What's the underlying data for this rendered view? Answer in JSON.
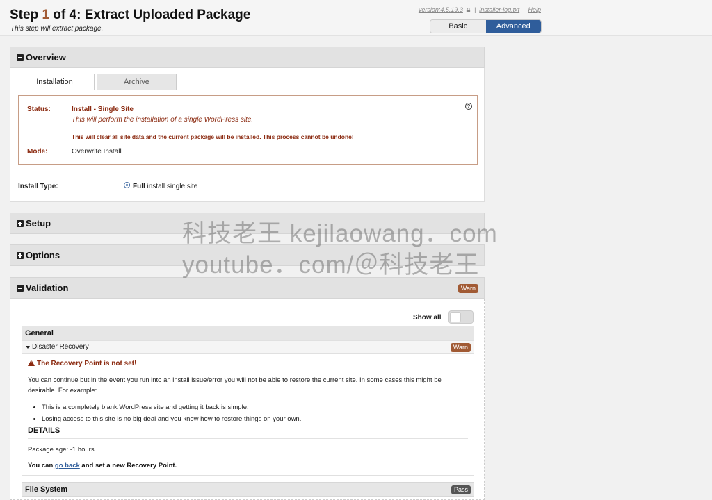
{
  "header": {
    "title_prefix": "Step ",
    "step_number": "1",
    "title_suffix": " of 4: Extract Uploaded Package",
    "subtitle": "This step will extract package.",
    "links": {
      "version": "version:4.5.19.3",
      "log": "installer-log.txt",
      "help": "Help",
      "sep1": "|",
      "sep2": "|"
    },
    "view_toggle": {
      "basic": "Basic",
      "advanced": "Advanced"
    }
  },
  "overview": {
    "title": "Overview",
    "tabs": [
      {
        "label": "Installation"
      },
      {
        "label": "Archive"
      }
    ],
    "status_label": "Status:",
    "status_value": "Install - Single Site",
    "status_desc": "This will perform the installation of a single WordPress site.",
    "warning": "This will clear all site data and the current package will be installed. This process cannot be undone!",
    "mode_label": "Mode:",
    "mode_value": "Overwrite Install",
    "help_glyph": "?",
    "install_type_label": "Install Type:",
    "install_type_bold": "Full",
    "install_type_rest": " install single site"
  },
  "setup": {
    "title": "Setup"
  },
  "options": {
    "title": "Options"
  },
  "validation": {
    "title": "Validation",
    "badge": "Warn",
    "show_all": "Show all",
    "general": {
      "title": "General",
      "disaster": {
        "title": "Disaster Recovery",
        "badge": "Warn",
        "alert": "The Recovery Point is not set!",
        "paragraph": "You can continue but in the event you run into an install issue/error you will not be able to restore the current site. In some cases this might be desirable. For example:",
        "bullets": [
          "This is a completely blank WordPress site and getting it back is simple.",
          "Losing access to this site is no big deal and you know how to restore things on your own."
        ],
        "details_heading": "DETAILS",
        "package_age": "Package age: -1 hours",
        "go_back_prefix": "You can ",
        "go_back_link": "go back",
        "go_back_suffix": " and set a new Recovery Point."
      }
    },
    "filesystem": {
      "title": "File System",
      "badge": "Pass"
    }
  },
  "watermark": {
    "line1": "科技老王 kejilaowang．com",
    "line2": "youtube．com/＠科技老王"
  },
  "colors": {
    "accent": "#2f5d9b",
    "warn": "#a15a34",
    "error_text": "#8b2a10",
    "pass": "#555555"
  }
}
